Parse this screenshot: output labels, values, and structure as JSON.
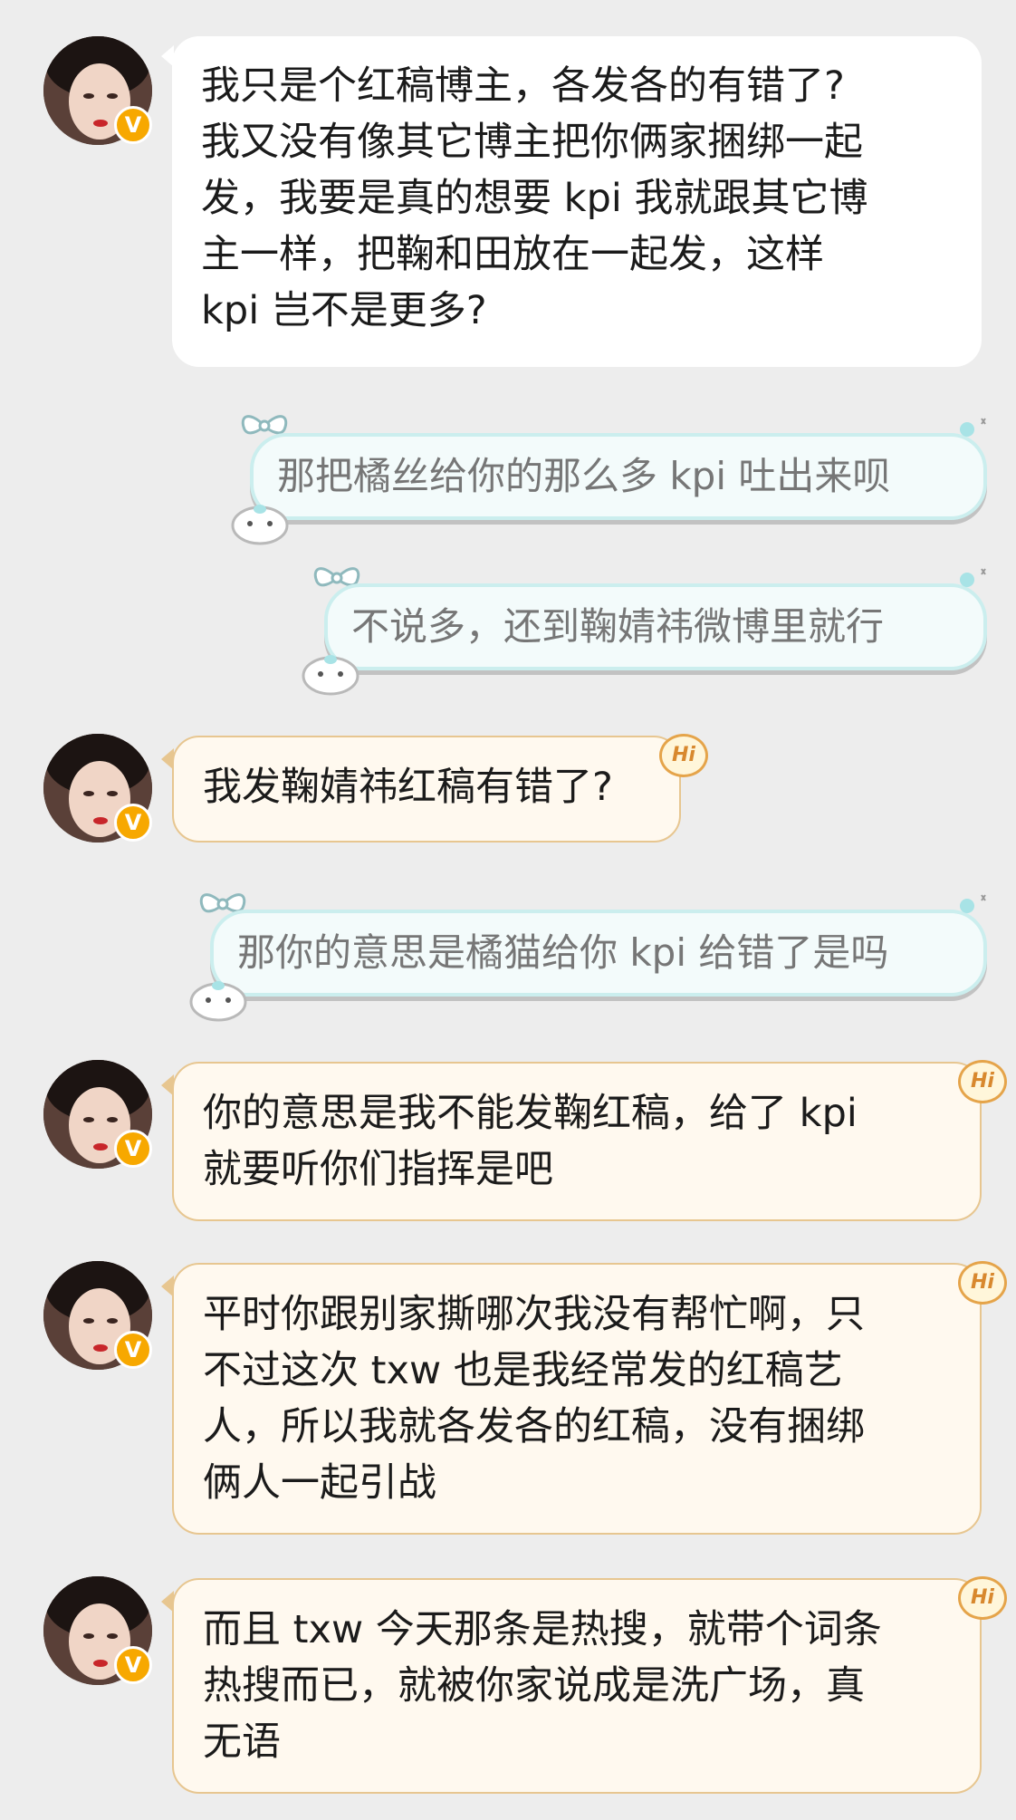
{
  "colors": {
    "background": "#ededed",
    "left_bubble_white": "#ffffff",
    "left_bubble_cream": "#fff9ef",
    "left_bubble_border": "#e7c690",
    "right_bubble_fill": "#f3fbfb",
    "right_bubble_border": "#cbeeee",
    "verified_badge": "#f7a800"
  },
  "messages": [
    {
      "side": "left",
      "style": "white",
      "lines": [
        "我只是个红稿博主，各发各的有错了?",
        "我又没有像其它博主把你俩家捆绑一起",
        "发，我要是真的想要 kpi 我就跟其它博",
        "主一样，把鞠和田放在一起发，这样",
        " kpi 岂不是更多?"
      ]
    },
    {
      "side": "right",
      "text": "那把橘丝给你的那么多 kpi 吐出来呗"
    },
    {
      "side": "right",
      "text": "不说多，还到鞠婧祎微博里就行"
    },
    {
      "side": "left",
      "style": "cream",
      "badge": "Hi",
      "lines": [
        "我发鞠婧祎红稿有错了?"
      ]
    },
    {
      "side": "right",
      "text": "那你的意思是橘猫给你 kpi 给错了是吗"
    },
    {
      "side": "left",
      "style": "cream",
      "badge": "Hi",
      "lines": [
        "你的意思是我不能发鞠红稿，给了 kpi",
        "就要听你们指挥是吧"
      ]
    },
    {
      "side": "left",
      "style": "cream",
      "badge": "Hi",
      "lines": [
        "平时你跟别家撕哪次我没有帮忙啊，只",
        "不过这次 txw 也是我经常发的红稿艺",
        "人，所以我就各发各的红稿，没有捆绑",
        "俩人一起引战"
      ]
    },
    {
      "side": "left",
      "style": "cream",
      "badge": "Hi",
      "lines": [
        "而且 txw 今天那条是热搜，就带个词条",
        "热搜而已，就被你家说成是洗广场，真",
        "无语"
      ]
    }
  ],
  "verified_badge_text": "V",
  "icons": {
    "avatar": "avatar",
    "verified": "verified-badge-icon",
    "hi": "hi-badge-icon",
    "bow": "bow-icon",
    "pet": "cat-sticker-icon",
    "sparkle": "sparkle-icon"
  }
}
